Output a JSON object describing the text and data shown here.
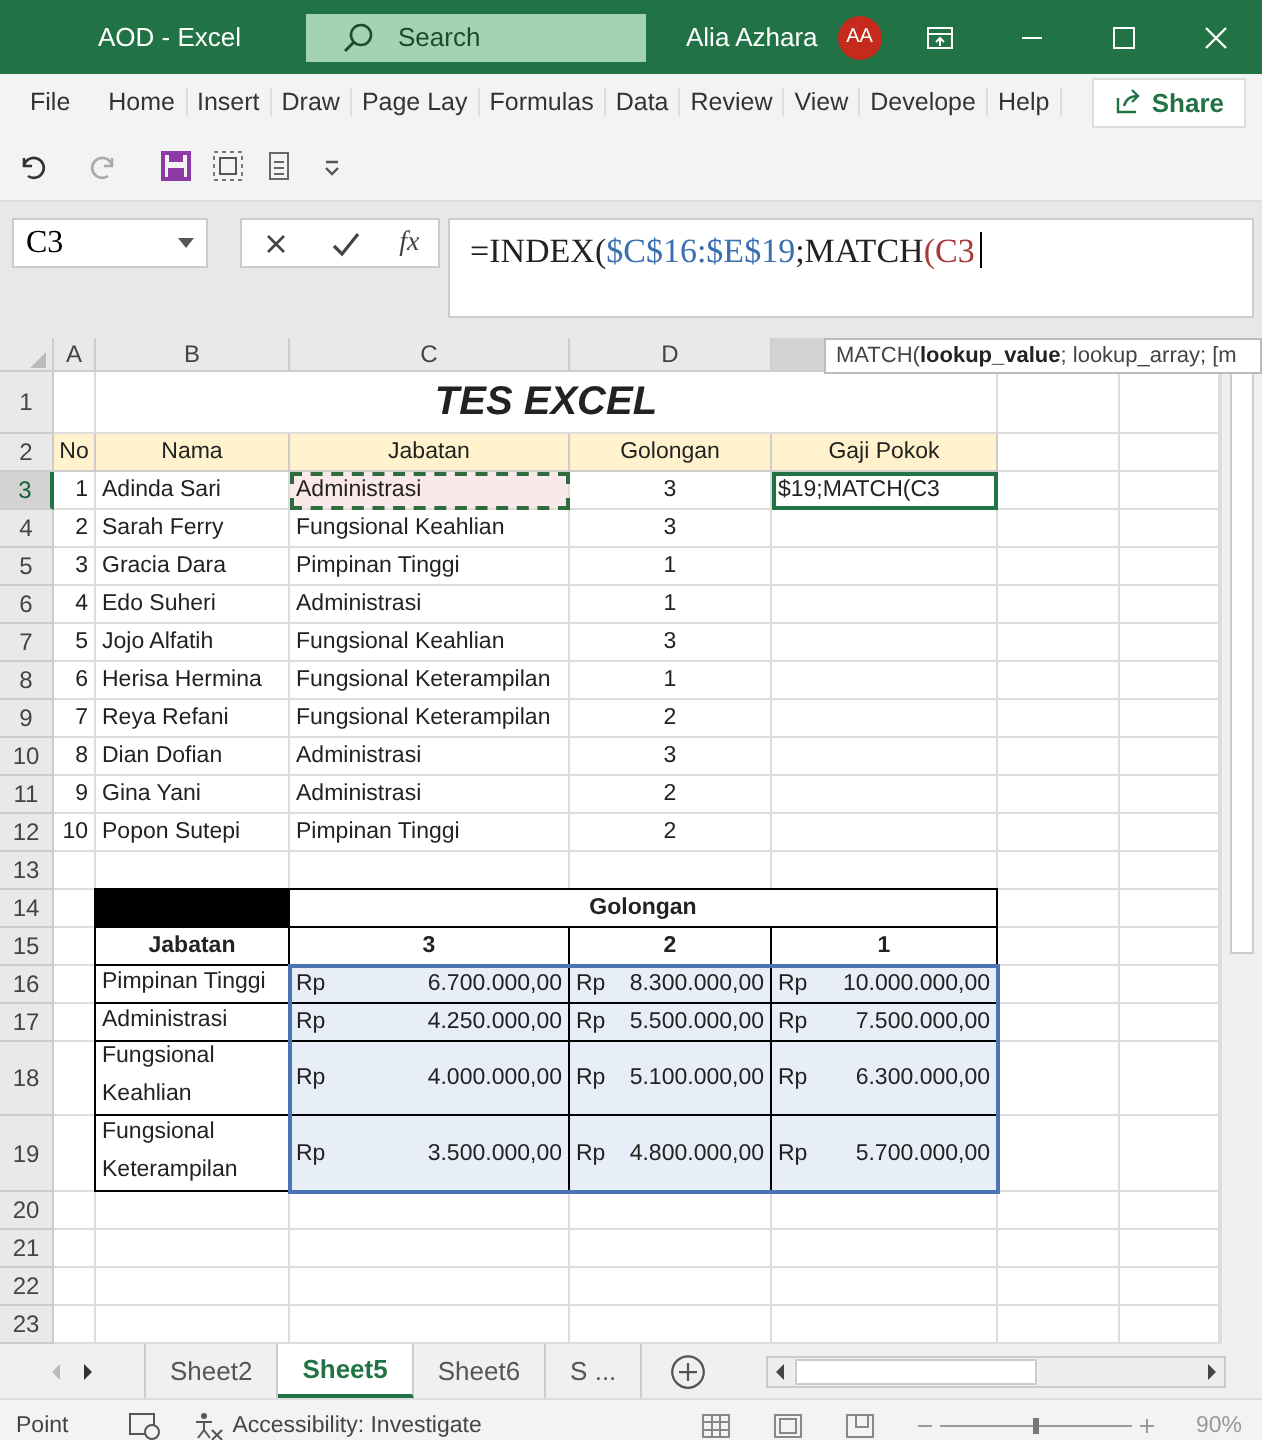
{
  "window": {
    "title": "AOD  -  Excel",
    "search": {
      "placeholder": "Search"
    },
    "user": "Alia Azhara",
    "avatar": "AA"
  },
  "ribbon_tabs": [
    "File",
    "Home",
    "Insert",
    "Draw",
    "Page Lay",
    "Formulas",
    "Data",
    "Review",
    "View",
    "Develope",
    "Help"
  ],
  "share": "Share",
  "formula_bar": {
    "name_box": "C3",
    "function_label": "fx",
    "parts": [
      {
        "text": "=INDEX(",
        "color": "#222222"
      },
      {
        "text": "$C$16:$E$19",
        "color": "#3a6fb0"
      },
      {
        "text": ";MATCH",
        "color": "#222222"
      },
      {
        "text": "(C3",
        "color": "#a83a3a"
      }
    ]
  },
  "tooltip": "MATCH(**lookup_value**; lookup_array; [m",
  "column_headers": [
    "A",
    "B",
    "C",
    "D"
  ],
  "row_numbers": [
    {
      "label": "1",
      "selected": false
    },
    {
      "label": "2",
      "selected": false
    },
    {
      "label": "3",
      "selected": true
    },
    {
      "label": "4",
      "selected": false
    },
    {
      "label": "5",
      "selected": false
    },
    {
      "label": "6",
      "selected": false
    },
    {
      "label": "7",
      "selected": false
    },
    {
      "label": "8",
      "selected": false
    },
    {
      "label": "9",
      "selected": false
    },
    {
      "label": "10",
      "selected": false
    },
    {
      "label": "11",
      "selected": false
    },
    {
      "label": "12",
      "selected": false
    },
    {
      "label": "13",
      "selected": false
    },
    {
      "label": "14",
      "selected": false
    },
    {
      "label": "15",
      "selected": false
    },
    {
      "label": "16",
      "selected": false
    },
    {
      "label": "17",
      "selected": false
    },
    {
      "label": "18",
      "selected": false
    },
    {
      "label": "19",
      "selected": false
    },
    {
      "label": "20",
      "selected": false
    },
    {
      "label": "21",
      "selected": false
    },
    {
      "label": "22",
      "selected": false
    },
    {
      "label": "23",
      "selected": false
    }
  ],
  "sheet_title": "TES EXCEL",
  "employee_table": {
    "columns": [
      "No",
      "Nama",
      "Jabatan",
      "Golongan",
      "Gaji Pokok"
    ],
    "edit_cell": "$19;MATCH(C3",
    "rows": [
      {
        "no": "1",
        "nama": "Adinda Sari",
        "jabatan": "Administrasi",
        "golongan": "3",
        "marked": true
      },
      {
        "no": "2",
        "nama": "Sarah Ferry",
        "jabatan": "Fungsional Keahlian",
        "golongan": "3",
        "marked": false
      },
      {
        "no": "3",
        "nama": "Gracia Dara",
        "jabatan": "Pimpinan Tinggi",
        "golongan": "1",
        "marked": false
      },
      {
        "no": "4",
        "nama": "Edo Suheri",
        "jabatan": "Administrasi",
        "golongan": "1",
        "marked": false
      },
      {
        "no": "5",
        "nama": "Jojo Alfatih",
        "jabatan": "Fungsional Keahlian",
        "golongan": "3",
        "marked": false
      },
      {
        "no": "6",
        "nama": "Herisa Hermina",
        "jabatan": "Fungsional Keterampilan",
        "golongan": "1",
        "marked": false
      },
      {
        "no": "7",
        "nama": "Reya Refani",
        "jabatan": "Fungsional Keterampilan",
        "golongan": "2",
        "marked": false
      },
      {
        "no": "8",
        "nama": "Dian Dofian",
        "jabatan": "Administrasi",
        "golongan": "3",
        "marked": false
      },
      {
        "no": "9",
        "nama": "Gina Yani",
        "jabatan": "Administrasi",
        "golongan": "2",
        "marked": false
      },
      {
        "no": "10",
        "nama": "Popon Sutepi",
        "jabatan": "Pimpinan Tinggi",
        "golongan": "2",
        "marked": false
      }
    ]
  },
  "salary_table": {
    "group_header": "Golongan",
    "row_header": "Jabatan",
    "columns": [
      "3",
      "2",
      "1"
    ],
    "selected": true,
    "rows": [
      {
        "jabatan": "Pimpinan Tinggi",
        "values": [
          {
            "currency": "Rp",
            "amount": "6.700.000,00"
          },
          {
            "currency": "Rp",
            "amount": "8.300.000,00"
          },
          {
            "currency": "Rp",
            "amount": "10.000.000,00"
          }
        ]
      },
      {
        "jabatan": "Administrasi",
        "values": [
          {
            "currency": "Rp",
            "amount": "4.250.000,00"
          },
          {
            "currency": "Rp",
            "amount": "5.500.000,00"
          },
          {
            "currency": "Rp",
            "amount": "7.500.000,00"
          }
        ]
      },
      {
        "jabatan": "Fungsional Keahlian",
        "values": [
          {
            "currency": "Rp",
            "amount": "4.000.000,00"
          },
          {
            "currency": "Rp",
            "amount": "5.100.000,00"
          },
          {
            "currency": "Rp",
            "amount": "6.300.000,00"
          }
        ]
      },
      {
        "jabatan": "Fungsional Keterampilan",
        "values": [
          {
            "currency": "Rp",
            "amount": "3.500.000,00"
          },
          {
            "currency": "Rp",
            "amount": "4.800.000,00"
          },
          {
            "currency": "Rp",
            "amount": "5.700.000,00"
          }
        ]
      }
    ]
  },
  "sheet_tabs": [
    {
      "label": "Sheet2",
      "selected": false
    },
    {
      "label": "Sheet5",
      "selected": true
    },
    {
      "label": "Sheet6",
      "selected": false
    },
    {
      "label": "S  ...",
      "selected": false
    }
  ],
  "status_bar": {
    "mode": "Point",
    "accessibility": "Accessibility: Investigate",
    "zoom": "90%",
    "zoom_slider": {
      "level": 0.5
    }
  }
}
